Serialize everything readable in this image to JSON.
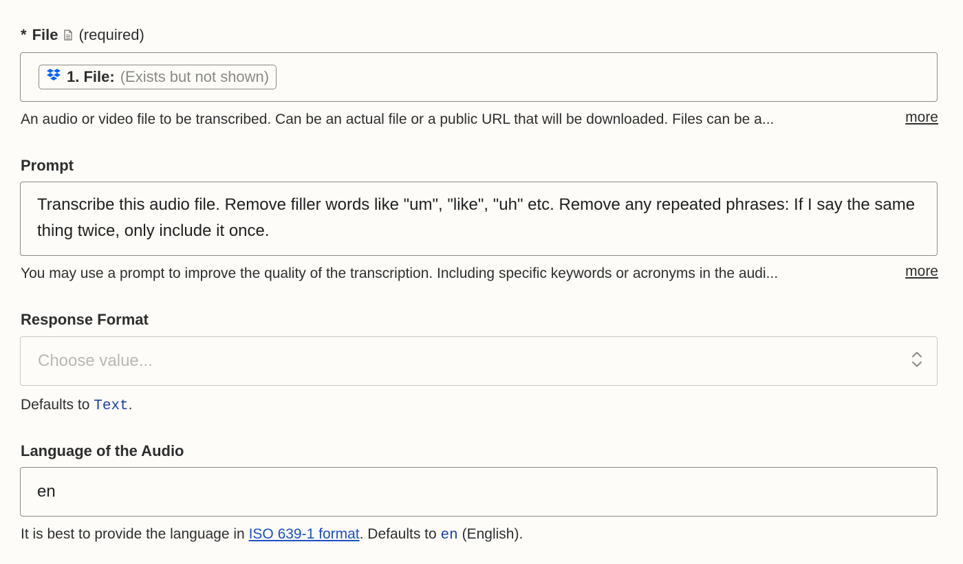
{
  "file_field": {
    "required_star": "*",
    "label": "File",
    "icon": "document-icon",
    "required_text": "(required)",
    "pill": {
      "icon": "dropbox-icon",
      "name": "1. File:",
      "value": "(Exists but not shown)"
    },
    "help": "An audio or video file to be transcribed. Can be an actual file or a public URL that will be downloaded. Files can be a...",
    "more": "more"
  },
  "prompt_field": {
    "label": "Prompt",
    "value": "Transcribe this audio file. Remove filler words like \"um\", \"like\", \"uh\" etc. Remove any repeated phrases: If I say the same thing twice, only include it once.",
    "help": "You may use a prompt to improve the quality of the transcription. Including specific keywords or acronyms in the audi...",
    "more": "more"
  },
  "response_format_field": {
    "label": "Response Format",
    "placeholder": "Choose value...",
    "icon": "chevron-up-down-icon",
    "help_prefix": "Defaults to ",
    "help_code": "Text",
    "help_suffix": "."
  },
  "language_field": {
    "label": "Language of the Audio",
    "value": "en",
    "help_prefix": "It is best to provide the language in ",
    "help_link": "ISO 639-1 format",
    "help_mid": ". Defaults to ",
    "help_code": "en",
    "help_suffix": " (English)."
  },
  "colors": {
    "background": "#fdfcf8",
    "border": "#8a8a85",
    "text": "#2d2e2e",
    "placeholder": "#b9b8b4",
    "link": "#1a4fc8",
    "code": "#1a3fa8",
    "dropbox": "#0061fe"
  }
}
